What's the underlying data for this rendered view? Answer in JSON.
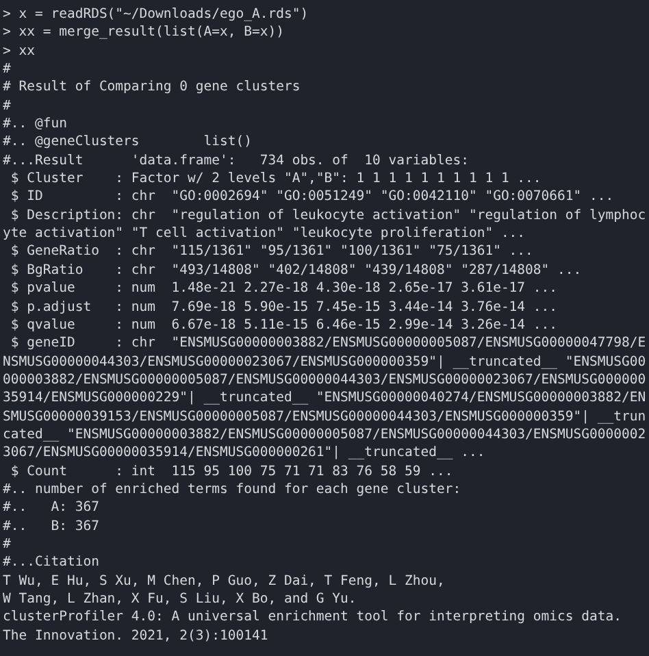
{
  "console": {
    "lines": [
      "> x = readRDS(\"~/Downloads/ego_A.rds\")",
      "> xx = merge_result(list(A=x, B=x))",
      "> xx",
      "#",
      "# Result of Comparing 0 gene clusters",
      "#",
      "#.. @fun",
      "#.. @geneClusters        list()",
      "#...Result      'data.frame':   734 obs. of  10 variables:",
      " $ Cluster    : Factor w/ 2 levels \"A\",\"B\": 1 1 1 1 1 1 1 1 1 1 ...",
      " $ ID         : chr  \"GO:0002694\" \"GO:0051249\" \"GO:0042110\" \"GO:0070661\" ...",
      " $ Description: chr  \"regulation of leukocyte activation\" \"regulation of lymphoc",
      "yte activation\" \"T cell activation\" \"leukocyte proliferation\" ...",
      " $ GeneRatio  : chr  \"115/1361\" \"95/1361\" \"100/1361\" \"75/1361\" ...",
      " $ BgRatio    : chr  \"493/14808\" \"402/14808\" \"439/14808\" \"287/14808\" ...",
      " $ pvalue     : num  1.48e-21 2.27e-18 4.30e-18 2.65e-17 3.61e-17 ...",
      " $ p.adjust   : num  7.69e-18 5.90e-15 7.45e-15 3.44e-14 3.76e-14 ...",
      " $ qvalue     : num  6.67e-18 5.11e-15 6.46e-15 2.99e-14 3.26e-14 ...",
      " $ geneID     : chr  \"ENSMUSG00000003882/ENSMUSG00000005087/ENSMUSG00000047798/E",
      "NSMUSG00000044303/ENSMUSG00000023067/ENSMUSG000000359\"| __truncated__ \"ENSMUSG00",
      "000003882/ENSMUSG00000005087/ENSMUSG00000044303/ENSMUSG00000023067/ENSMUSG000000",
      "35914/ENSMUSG000000229\"| __truncated__ \"ENSMUSG00000040274/ENSMUSG00000003882/EN",
      "SMUSG00000039153/ENSMUSG00000005087/ENSMUSG00000044303/ENSMUSG000000359\"| __trun",
      "cated__ \"ENSMUSG00000003882/ENSMUSG00000005087/ENSMUSG00000044303/ENSMUSG0000002",
      "3067/ENSMUSG00000035914/ENSMUSG000000261\"| __truncated__ ...",
      " $ Count      : int  115 95 100 75 71 71 83 76 58 59 ...",
      "#.. number of enriched terms found for each gene cluster:",
      "#..   A: 367",
      "#..   B: 367",
      "#",
      "#...Citation",
      "T Wu, E Hu, S Xu, M Chen, P Guo, Z Dai, T Feng, L Zhou,",
      "W Tang, L Zhan, X Fu, S Liu, X Bo, and G Yu.",
      "clusterProfiler 4.0: A universal enrichment tool for interpreting omics data.",
      "The Innovation. 2021, 2(3):100141"
    ]
  }
}
